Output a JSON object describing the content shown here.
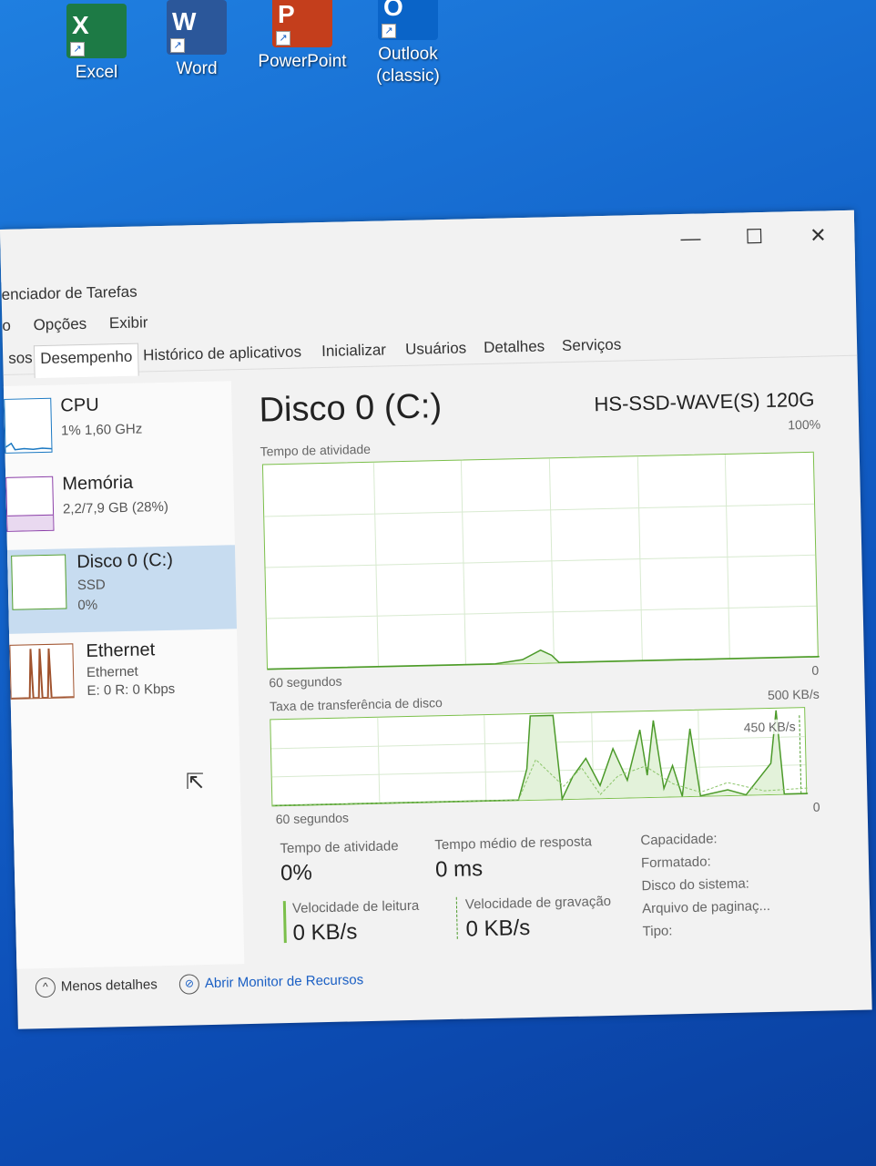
{
  "desktop": {
    "icons": [
      {
        "label": "Excel",
        "glyph": "X",
        "color": "#1d7a45"
      },
      {
        "label": "Word",
        "glyph": "W",
        "color": "#2b579a"
      },
      {
        "label": "PowerPoint",
        "glyph": "P",
        "color": "#c43e1c"
      },
      {
        "label": "Outlook\n(classic)",
        "glyph": "O",
        "color": "#0a64c8"
      }
    ]
  },
  "window": {
    "title": "enciador de Tarefas",
    "controls": {
      "minimize": "—",
      "maximize": "☐",
      "close": "✕"
    },
    "menu": [
      "o",
      "Opções",
      "Exibir"
    ],
    "tabs": [
      "sos",
      "Desempenho",
      "Histórico de aplicativos",
      "Inicializar",
      "Usuários",
      "Detalhes",
      "Serviços"
    ],
    "active_tab": "Desempenho",
    "side": [
      {
        "name": "CPU",
        "sub1": "1% 1,60 GHz",
        "sub2": "",
        "color": "#1a78c2"
      },
      {
        "name": "Memória",
        "sub1": "2,2/7,9 GB (28%)",
        "sub2": "",
        "color": "#8b3fa8"
      },
      {
        "name": "Disco 0 (C:)",
        "sub1": "SSD",
        "sub2": "0%",
        "color": "#4c9a2a"
      },
      {
        "name": "Ethernet",
        "sub1": "Ethernet",
        "sub2": "E: 0 R: 0 Kbps",
        "color": "#a0522d"
      }
    ],
    "main": {
      "title": "Disco 0 (C:)",
      "model": "HS-SSD-WAVE(S) 120G",
      "graph1": {
        "label": "Tempo de atividade",
        "max": "100%",
        "time": "60 segundos",
        "min": "0"
      },
      "graph2": {
        "label": "Taxa de transferência de disco",
        "max": "500 KB/s",
        "inner": "450 KB/s",
        "time": "60 segundos",
        "min": "0"
      },
      "stats": {
        "activity_label": "Tempo de atividade",
        "activity_value": "0%",
        "response_label": "Tempo médio de resposta",
        "response_value": "0 ms",
        "read_label": "Velocidade de leitura",
        "read_value": "0 KB/s",
        "write_label": "Velocidade de gravação",
        "write_value": "0 KB/s"
      },
      "properties": [
        "Capacidade:",
        "Formatado:",
        "Disco do sistema:",
        "Arquivo de paginaç...",
        "Tipo:"
      ]
    },
    "footer": {
      "less": "Menos detalhes",
      "monitor": "Abrir Monitor de Recursos"
    }
  }
}
